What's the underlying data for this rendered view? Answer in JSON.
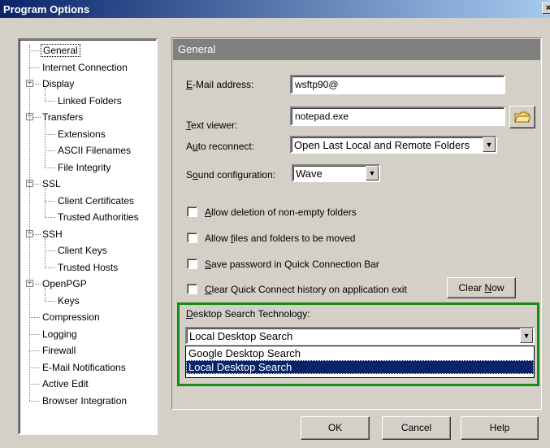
{
  "window": {
    "title": "Program Options",
    "close_label": "×"
  },
  "tree": {
    "items": [
      {
        "label": "General",
        "level": 1,
        "selected": true
      },
      {
        "label": "Internet Connection",
        "level": 1
      },
      {
        "label": "Display",
        "level": 1,
        "expander": "−"
      },
      {
        "label": "Linked Folders",
        "level": 2
      },
      {
        "label": "Transfers",
        "level": 1,
        "expander": "−"
      },
      {
        "label": "Extensions",
        "level": 2
      },
      {
        "label": "ASCII Filenames",
        "level": 2
      },
      {
        "label": "File Integrity",
        "level": 2
      },
      {
        "label": "SSL",
        "level": 1,
        "expander": "−"
      },
      {
        "label": "Client Certificates",
        "level": 2
      },
      {
        "label": "Trusted Authorities",
        "level": 2
      },
      {
        "label": "SSH",
        "level": 1,
        "expander": "−"
      },
      {
        "label": "Client Keys",
        "level": 2
      },
      {
        "label": "Trusted Hosts",
        "level": 2
      },
      {
        "label": "OpenPGP",
        "level": 1,
        "expander": "−"
      },
      {
        "label": "Keys",
        "level": 2
      },
      {
        "label": "Compression",
        "level": 1
      },
      {
        "label": "Logging",
        "level": 1
      },
      {
        "label": "Firewall",
        "level": 1
      },
      {
        "label": "E-Mail Notifications",
        "level": 1
      },
      {
        "label": "Active Edit",
        "level": 1
      },
      {
        "label": "Browser Integration",
        "level": 1
      }
    ]
  },
  "general": {
    "header": "General",
    "email": {
      "label_u": "E",
      "label_rest": "-Mail address:",
      "value": "wsftp90@"
    },
    "text_viewer": {
      "label_u": "T",
      "label_rest": "ext viewer:",
      "value": "notepad.exe",
      "icon": "folder-icon"
    },
    "auto_reconnect": {
      "label_pre": "A",
      "label_u": "u",
      "label_rest": "to reconnect:",
      "value": "Open Last Local and Remote Folders"
    },
    "sound": {
      "label_pre": "S",
      "label_u": "o",
      "label_rest": "und configuration:",
      "value": "Wave"
    },
    "checkboxes": [
      {
        "u": "A",
        "rest": "llow deletion of non-empty folders",
        "checked": false
      },
      {
        "pre": "Allow ",
        "u": "f",
        "rest": "iles and folders to be moved",
        "checked": false
      },
      {
        "u": "S",
        "rest": "ave password in Quick Connection Bar",
        "checked": false
      },
      {
        "u": "C",
        "rest": "lear Quick Connect history on application exit",
        "checked": false
      }
    ],
    "clear_now": {
      "pre": "Clear ",
      "u": "N",
      "rest": "ow"
    },
    "desktop_search": {
      "label_u": "D",
      "label_rest": "esktop Search Technology:",
      "value": "Local Desktop Search",
      "options": [
        "Google Desktop Search",
        "Local Desktop Search"
      ],
      "highlight_color": "#168b16"
    }
  },
  "buttons": {
    "ok": "OK",
    "cancel": "Cancel",
    "help": "Help"
  }
}
